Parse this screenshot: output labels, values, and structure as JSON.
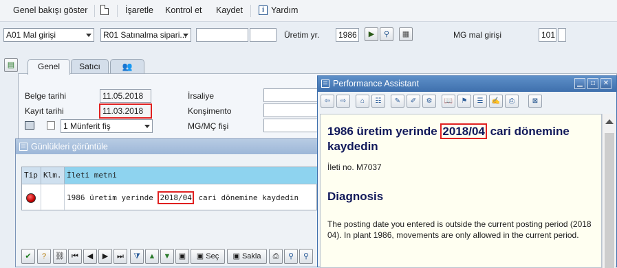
{
  "menu": {
    "items": [
      "Genel bakışı göster",
      "İşaretle",
      "Kontrol et",
      "Kaydet",
      "Yardım"
    ]
  },
  "selection": {
    "action": "A01 Mal girişi",
    "reference": "R01 Satınalma sipari...",
    "plant_label": "Üretim yr.",
    "plant_value": "1986",
    "movement_label": "MG mal girişi",
    "movement_value": "101"
  },
  "tabs": [
    "Genel",
    "Satıcı"
  ],
  "header": {
    "doc_date_label": "Belge tarihi",
    "doc_date": "11.05.2018",
    "post_date_label": "Kayıt tarihi",
    "post_date": "11.03.2018",
    "slip_label": "İrsaliye",
    "bol_label": "Konşimento",
    "gr_slip_label": "MG/MÇ fişi",
    "print_option": "1 Münferit fiş"
  },
  "log_window": {
    "title": "Günlükleri görüntüle",
    "columns": [
      "Tip",
      "Klm.",
      "İleti metni"
    ],
    "row": {
      "text_before": "1986 üretim yerinde ",
      "period": "2018/04",
      "text_after": " cari dönemine kaydedin"
    },
    "buttons": {
      "select": "Seç",
      "save": "Sakla"
    }
  },
  "assistant": {
    "title": "Performance Assistant",
    "heading_before": "1986 üretim yerinde ",
    "heading_period": "2018/04",
    "heading_after": " cari dönemine kaydedin",
    "message_no": "İleti no. M7037",
    "diagnosis_title": "Diagnosis",
    "diagnosis_text": "The posting date you entered is outside the current posting period (2018 04). In plant 1986, movements are only allowed in the current period."
  },
  "colors": {
    "title_bar": "#3f70ad",
    "highlight_box": "#e02020",
    "heading_text": "#10185a",
    "error_light": "#d40000"
  }
}
